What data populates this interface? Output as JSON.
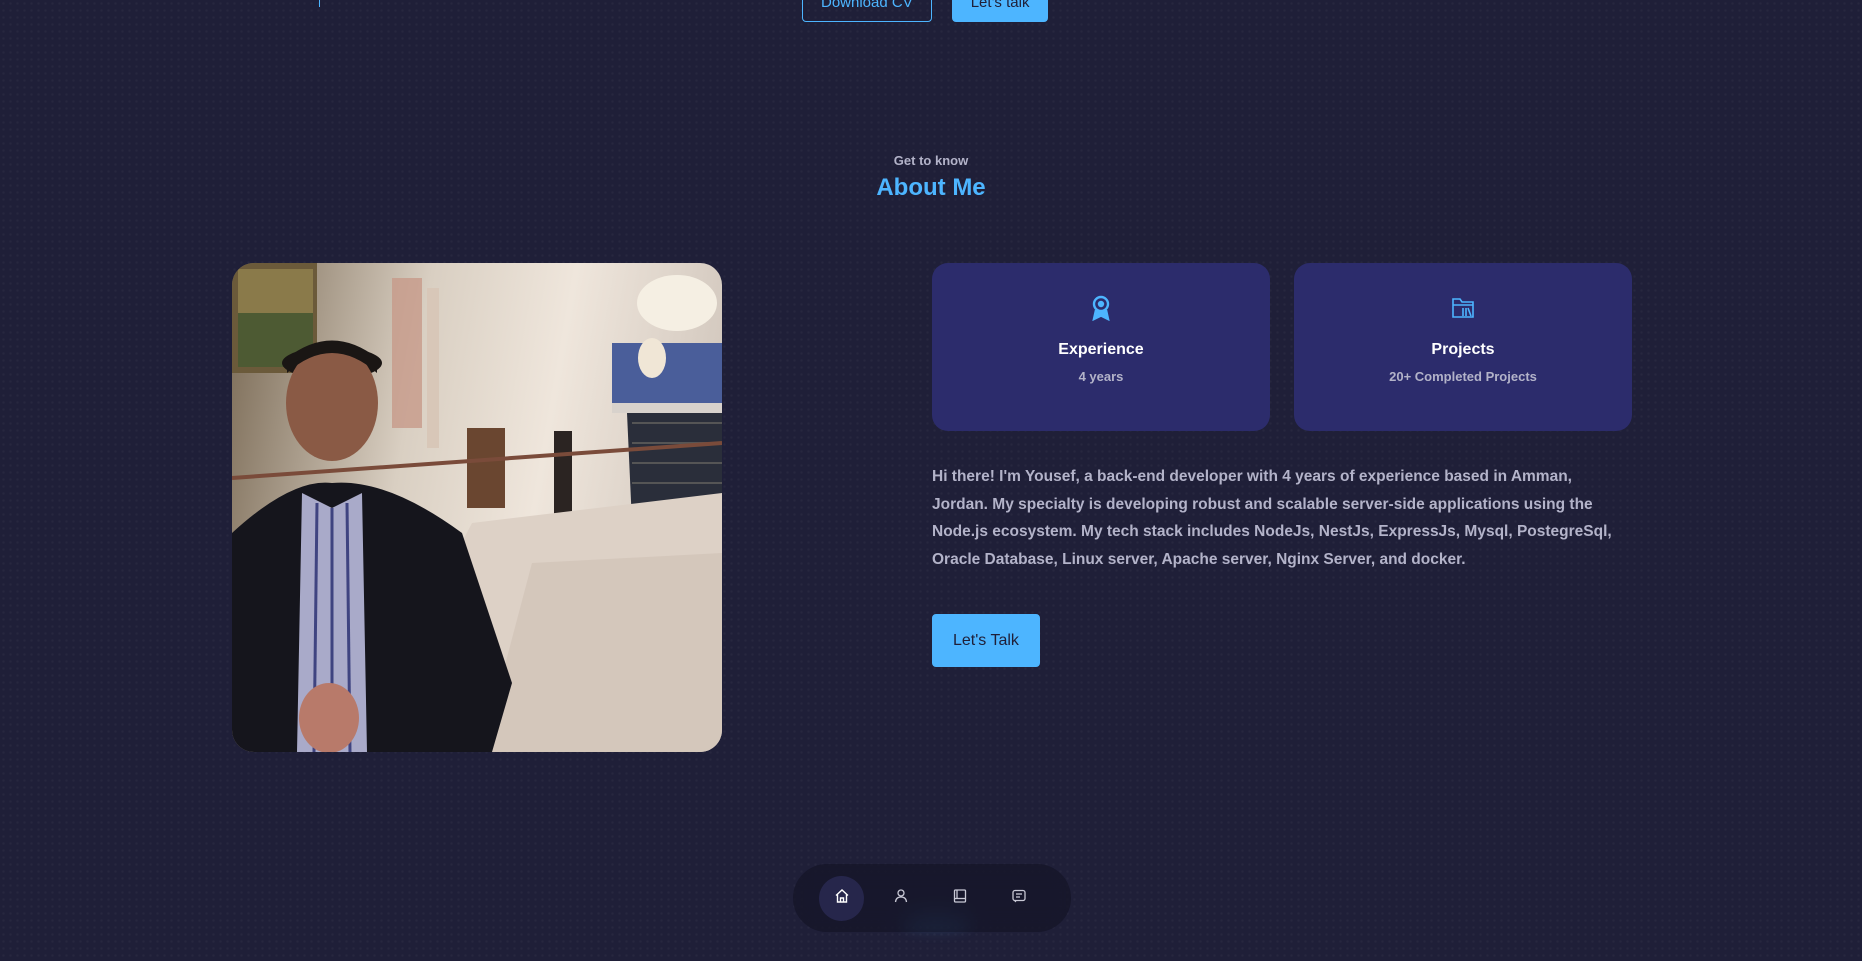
{
  "hero": {
    "download_cv_label": "Download CV",
    "lets_talk_label": "Let's talk"
  },
  "about": {
    "kicker": "Get to know",
    "heading": "About Me",
    "cards": [
      {
        "icon": "award-icon",
        "title": "Experience",
        "subtitle": "4 years"
      },
      {
        "icon": "folder-icon",
        "title": "Projects",
        "subtitle": "20+ Completed Projects"
      }
    ],
    "bio": "Hi there! I'm Yousef, a back-end developer with 4 years of experience based in Amman, Jordan. My specialty is developing robust and scalable server-side applications using the Node.js ecosystem. My tech stack includes NodeJs, NestJs, ExpressJs, Mysql, PostegreSql, Oracle Database, Linux server, Apache server, Nginx Server, and docker.",
    "cta_label": "Let's Talk"
  },
  "nav": {
    "items": [
      {
        "icon": "home-icon",
        "active": true
      },
      {
        "icon": "user-icon",
        "active": false
      },
      {
        "icon": "book-icon",
        "active": false
      },
      {
        "icon": "message-icon",
        "active": false
      }
    ]
  },
  "colors": {
    "background": "#1f1f38",
    "accent": "#4db5ff",
    "card": "#2c2c6c",
    "text_muted": "#b3b3c9"
  }
}
